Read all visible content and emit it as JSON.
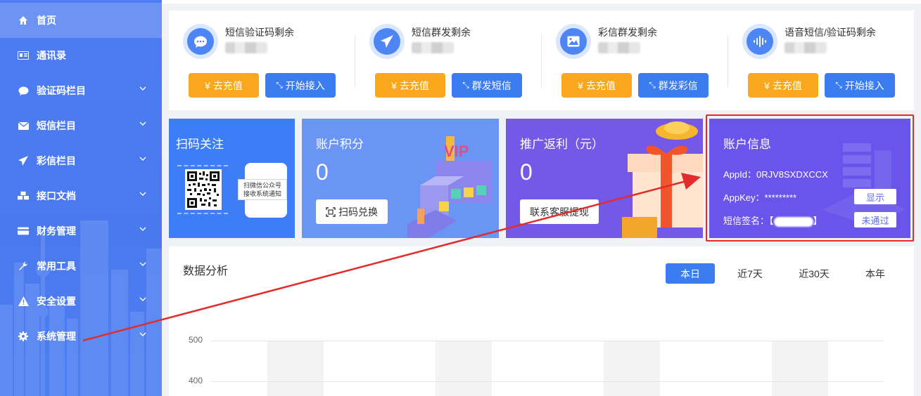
{
  "sidebar": {
    "items": [
      {
        "label": "首页",
        "icon": "home-icon",
        "active": true
      },
      {
        "label": "通讯录",
        "icon": "contact-card-icon"
      },
      {
        "label": "验证码栏目",
        "icon": "chat-bubble-icon",
        "arrow": true
      },
      {
        "label": "短信栏目",
        "icon": "envelope-icon",
        "arrow": true
      },
      {
        "label": "彩信栏目",
        "icon": "paper-plane-icon",
        "arrow": true
      },
      {
        "label": "接口文档",
        "icon": "cubes-icon",
        "arrow": true
      },
      {
        "label": "财务管理",
        "icon": "credit-card-icon",
        "arrow": true
      },
      {
        "label": "常用工具",
        "icon": "wrench-icon",
        "arrow": true
      },
      {
        "label": "安全设置",
        "icon": "warning-icon",
        "arrow": true
      },
      {
        "label": "系统管理",
        "icon": "gear-icon",
        "arrow": true
      }
    ]
  },
  "stats": [
    {
      "title": "短信验证码剩余",
      "icon": "chat-bubble-icon",
      "recharge": "去充值",
      "action": "开始接入"
    },
    {
      "title": "短信群发剩余",
      "icon": "paper-plane-icon",
      "recharge": "去充值",
      "action": "群发短信"
    },
    {
      "title": "彩信群发剩余",
      "icon": "image-icon",
      "recharge": "去充值",
      "action": "群发彩信"
    },
    {
      "title": "语音短信/验证码剩余",
      "icon": "voice-wave-icon",
      "recharge": "去充值",
      "action": "开始接入"
    }
  ],
  "currency_symbol": "¥",
  "promo": {
    "scan": {
      "title": "扫码关注",
      "note_line1": "扫微信公众号",
      "note_line2": "接收系统通知"
    },
    "points": {
      "title": "账户积分",
      "value": "0",
      "button": "扫码兑换"
    },
    "rebate": {
      "title": "推广返利（元）",
      "value": "0",
      "button": "联系客服提现"
    },
    "account": {
      "title": "账户信息",
      "appid_label": "AppId：",
      "appid_value": "0RJV8SXDXCCX",
      "appkey_label": "AppKey：",
      "appkey_value": "*********",
      "sign_label": "短信签名：",
      "sign_open": "【",
      "sign_close": "】",
      "show_button": "显示",
      "status_button": "未通过"
    }
  },
  "analysis": {
    "title": "数据分析",
    "tabs": [
      "本日",
      "近7天",
      "近30天",
      "本年"
    ],
    "active_tab": 0
  },
  "chart_data": {
    "type": "bar",
    "y_ticks": [
      "500",
      "400"
    ]
  },
  "colors": {
    "sidebar": "#4e7df3",
    "accent_blue": "#3c7cf1",
    "accent_orange": "#f9a81e",
    "annotation_red": "#e22c2c"
  }
}
